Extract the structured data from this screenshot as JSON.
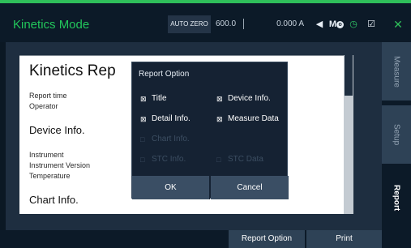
{
  "header": {
    "title": "Kinetics Mode",
    "auto_zero_label": "AUTO ZERO",
    "wavelength": "600.0",
    "separator": "|",
    "absorbance": "0.000 A",
    "icons": [
      "speaker-icon",
      "mo-icon",
      "power-icon",
      "edit-icon",
      "close-icon"
    ],
    "mo_label": "M",
    "mo_sub": "o",
    "speaker_glyph": "◀",
    "power_glyph": "◷",
    "edit_glyph": "☑",
    "close_glyph": "✕",
    "colors": {
      "accent": "#2fbf5a",
      "background": "#0c1a28"
    }
  },
  "sidebar": {
    "tabs": [
      {
        "label": "Measure",
        "active": false
      },
      {
        "label": "Setup",
        "active": false
      },
      {
        "label": "Report",
        "active": true
      }
    ]
  },
  "document": {
    "title": "Kinetics Rep",
    "report_time_label": "Report time",
    "operator_label": "Operator",
    "device_info_heading": "Device Info.",
    "instrument_label": "Instrument",
    "instrument_version_label": "Instrument Version",
    "temperature_label": "Temperature",
    "chart_info_heading": "Chart Info."
  },
  "dialog": {
    "title": "Report Option",
    "options": [
      {
        "label": "Title",
        "checked": true,
        "enabled": true
      },
      {
        "label": "Device Info.",
        "checked": true,
        "enabled": true
      },
      {
        "label": "Detail Info.",
        "checked": true,
        "enabled": true
      },
      {
        "label": "Measure Data",
        "checked": true,
        "enabled": true
      },
      {
        "label": "Chart Info.",
        "checked": false,
        "enabled": false
      },
      {
        "label": "STC Info.",
        "checked": false,
        "enabled": false
      },
      {
        "label": "STC Data",
        "checked": false,
        "enabled": false
      }
    ],
    "checked_glyph": "⊠",
    "unchecked_glyph": "□",
    "ok_label": "OK",
    "cancel_label": "Cancel"
  },
  "bottom": {
    "report_option_label": "Report Option",
    "print_label": "Print"
  }
}
